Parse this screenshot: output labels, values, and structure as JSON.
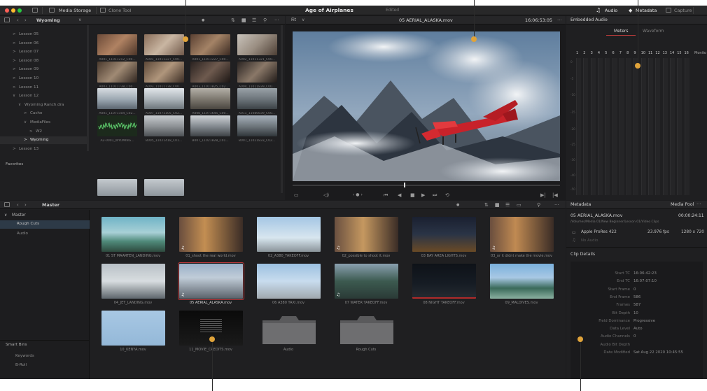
{
  "topbar": {
    "media_storage": "Media Storage",
    "clone_tool": "Clone Tool",
    "project_title": "Age of Airplanes",
    "status": "Edited",
    "audio": "Audio",
    "metadata": "Metadata",
    "capture": "Capture"
  },
  "media_storage": {
    "location": "Wyoming",
    "tree": [
      {
        "label": "Lesson 05",
        "chevron": ">"
      },
      {
        "label": "Lesson 06",
        "chevron": ">"
      },
      {
        "label": "Lesson 07",
        "chevron": ">"
      },
      {
        "label": "Lesson 08",
        "chevron": ">"
      },
      {
        "label": "Lesson 09",
        "chevron": ">"
      },
      {
        "label": "Lesson 10",
        "chevron": ">"
      },
      {
        "label": "Lesson 11",
        "chevron": ">"
      },
      {
        "label": "Lesson 12",
        "chevron": "∨"
      },
      {
        "label": "Wyoming Ranch.dra",
        "chevron": "∨"
      },
      {
        "label": "Cache",
        "chevron": ">"
      },
      {
        "label": "MediaFiles",
        "chevron": "∨"
      },
      {
        "label": "W2",
        "chevron": ">"
      },
      {
        "label": "Wyoming",
        "chevron": ">"
      },
      {
        "label": "Lesson 13",
        "chevron": ">"
      }
    ],
    "favorites": "Favorites",
    "clips": [
      "A001_11011212_C00...",
      "A001_11011227_C00...",
      "A001_11011227_C00...",
      "A002_11011321_C00...",
      "A003_11011738_C00...",
      "A003_11011738_C00...",
      "A003_11011825_C02...",
      "A004_11011839_C00...",
      "A001_11071104_C02...",
      "A007_11071105_C02...",
      "A008_11071645_C00...",
      "A011_11080839_C00...",
      "A2-0001_WYOMING...",
      "B005_11021418_C01...",
      "B007_11021828_C01...",
      "B007_11021833_C02..."
    ]
  },
  "viewer": {
    "zoom": "Fit",
    "clip_name": "05 AERIAL_ALASKA.mov",
    "timecode": "16:06:53:05"
  },
  "audio_panel": {
    "title": "Embedded Audio",
    "tab_meters": "Meters",
    "tab_waveform": "Waveform",
    "channels": [
      "1",
      "2",
      "3",
      "4",
      "5",
      "6",
      "7",
      "8",
      "9",
      "10",
      "11",
      "12",
      "13",
      "14",
      "15",
      "16"
    ],
    "monitor": "Monito",
    "scale": [
      "0",
      "-5",
      "-10",
      "-15",
      "-20",
      "-25",
      "-30",
      "-40",
      "-50"
    ]
  },
  "media_pool": {
    "bin": "Master",
    "master": "Master",
    "sub_bins": [
      "Rough Cuts",
      "Audio"
    ],
    "smart_bins": "Smart Bins",
    "smart_items": [
      "Keywords",
      "B-Roll"
    ],
    "clips": [
      "01 ST MAARTEN_LANDING.mov",
      "01_shoot the real world.mov",
      "02_A380_TAKEOFF.mov",
      "02_possible to shoot it.mov",
      "03 BAY AREA LIGHTS.mov",
      "03_or it didnt make the movie.mov",
      "04_JET_LANDING.mov",
      "05 AERIAL_ALASKA.mov",
      "06 A380 TAXI.mov",
      "07 WATER TAKEOFF.mov",
      "08 NIGHT TAKEOFF.mov",
      "09_MALDIVES.mov",
      "10_KENYA.mov",
      "11_MOVIE_CREDITS.mov",
      "Audio",
      "Rough Cuts"
    ]
  },
  "metadata": {
    "title": "Metadata",
    "pool_label": "Media Pool",
    "file_name": "05 AERIAL_ALASKA.mov",
    "duration": "00:00:24:11",
    "path": "/Volumes/Media 01/New Beginner/Lesson 01/Video Clips",
    "codec": "Apple ProRes 422",
    "fps": "23.976 fps",
    "resolution": "1280 x 720",
    "no_audio": "No Audio",
    "section": "Clip Details",
    "details": [
      {
        "key": "Start TC",
        "value": "16:06:42:23"
      },
      {
        "key": "End TC",
        "value": "16:07:07:10"
      },
      {
        "key": "Start Frame",
        "value": "0"
      },
      {
        "key": "End Frame",
        "value": "586"
      },
      {
        "key": "Frames",
        "value": "587"
      },
      {
        "key": "Bit Depth",
        "value": "10"
      },
      {
        "key": "Field Dominance",
        "value": "Progressive"
      },
      {
        "key": "Data Level",
        "value": "Auto"
      },
      {
        "key": "Audio Channels",
        "value": "0"
      },
      {
        "key": "Audio Bit Depth",
        "value": ""
      },
      {
        "key": "Date Modified",
        "value": "Sat Aug 22 2020 10:45:55"
      }
    ]
  }
}
